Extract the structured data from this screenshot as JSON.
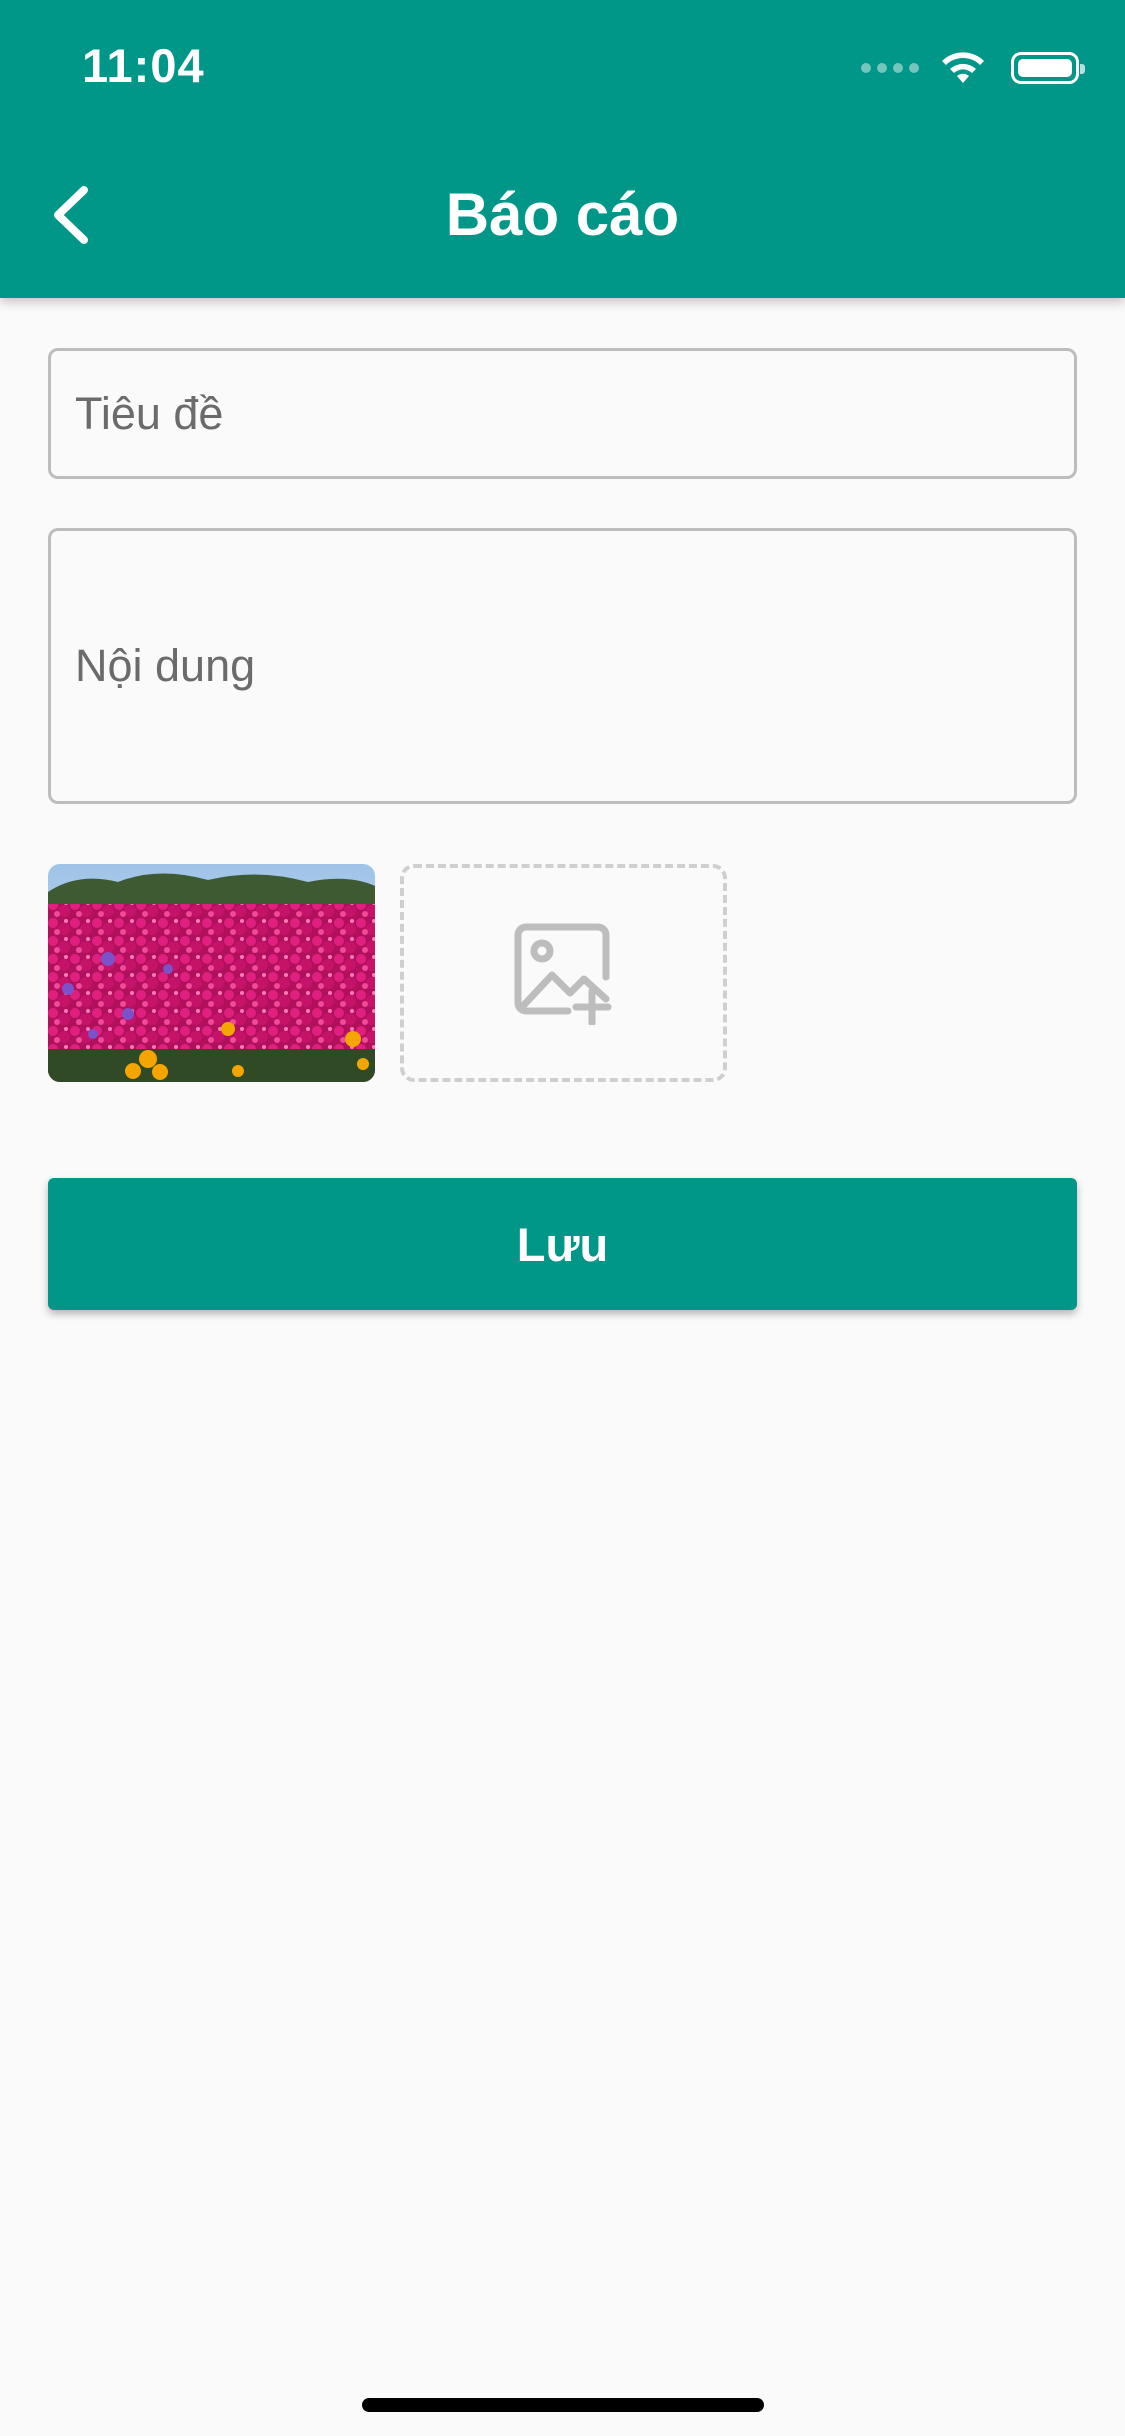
{
  "status_bar": {
    "time": "11:04",
    "icons": [
      "cellular-signal-icon",
      "wifi-icon",
      "battery-icon"
    ]
  },
  "app_bar": {
    "back_icon": "chevron-left-icon",
    "title": "Báo cáo",
    "color": "#009688"
  },
  "form": {
    "title_placeholder": "Tiêu đề",
    "content_placeholder": "Nội dung"
  },
  "attachments": {
    "add_icon": "add-image-icon"
  },
  "actions": {
    "save_label": "Lưu"
  }
}
